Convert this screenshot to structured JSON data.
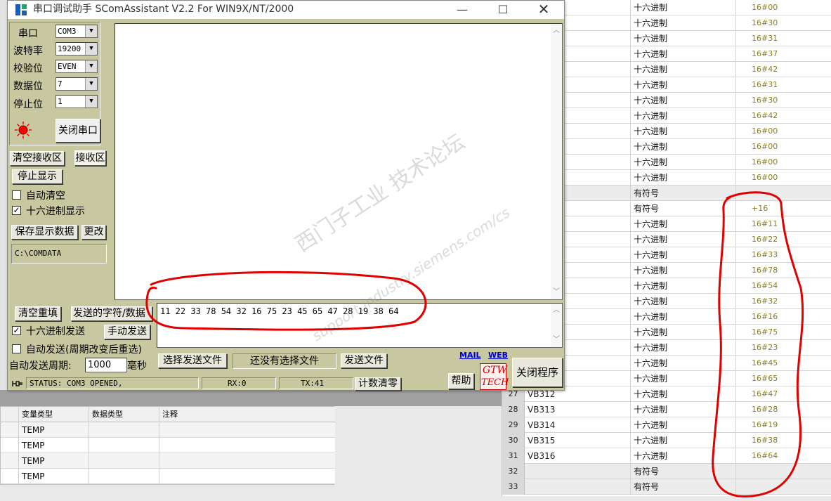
{
  "app": {
    "title": "串口调试助手 SComAssistant V2.2 For WIN9X/NT/2000",
    "minimize": "—",
    "maximize": "☐",
    "close": "✕"
  },
  "serial_settings": {
    "port_label": "串口",
    "port_value": "COM3",
    "baud_label": "波特率",
    "baud_value": "19200",
    "parity_label": "校验位",
    "parity_value": "EVEN",
    "databits_label": "数据位",
    "databits_value": "7",
    "stopbits_label": "停止位",
    "stopbits_value": "1",
    "close_port_button": "关闭串口",
    "indicator_color": "#ff0000"
  },
  "receive_controls": {
    "clear_receive_button": "清空接收区",
    "receive_area_label": "接收区",
    "stop_display_button": "停止显示",
    "auto_clear_label": "自动清空",
    "auto_clear_checked": false,
    "hex_display_label": "十六进制显示",
    "hex_display_checked": true,
    "save_data_button": "保存显示数据",
    "change_button": "更改",
    "save_path": "C:\\COMDATA"
  },
  "send_controls": {
    "clear_refill_button": "清空重填",
    "send_string_label": "发送的字符/数据",
    "send_text": "11 22 33 78 54 32 16 75 23 45 65 47 28 19 38 64",
    "hex_send_label": "十六进制发送",
    "hex_send_checked": true,
    "manual_send_button": "手动发送",
    "auto_send_label": "自动发送(周期改变后重选)",
    "auto_send_checked": false,
    "auto_send_period_label": "自动发送周期:",
    "auto_send_period_value": "1000",
    "period_unit": "毫秒",
    "select_file_button": "选择发送文件",
    "file_status": "还没有选择文件",
    "send_file_button": "发送文件",
    "mail_link": "MAIL",
    "web_link": "WEB",
    "help_button": "帮助",
    "logo_text_1": "GTW",
    "logo_text_2": "TECH",
    "close_program_button": "关闭程序"
  },
  "status_bar": {
    "status": "STATUS: COM3 OPENED,",
    "rx": "RX:0",
    "tx": "TX:41",
    "reset_count_button": "计数清零"
  },
  "status_table": {
    "rows": [
      {
        "num": "",
        "addr": "",
        "fmt": "十六进制",
        "val": "16#00"
      },
      {
        "num": "",
        "addr": "",
        "fmt": "十六进制",
        "val": "16#30"
      },
      {
        "num": "",
        "addr": "",
        "fmt": "十六进制",
        "val": "16#31"
      },
      {
        "num": "",
        "addr": "",
        "fmt": "十六进制",
        "val": "16#37"
      },
      {
        "num": "",
        "addr": "",
        "fmt": "十六进制",
        "val": "16#42"
      },
      {
        "num": "",
        "addr": "",
        "fmt": "十六进制",
        "val": "16#31"
      },
      {
        "num": "",
        "addr": "",
        "fmt": "十六进制",
        "val": "16#30"
      },
      {
        "num": "",
        "addr": "",
        "fmt": "十六进制",
        "val": "16#42"
      },
      {
        "num": "",
        "addr": "",
        "fmt": "十六进制",
        "val": "16#00"
      },
      {
        "num": "",
        "addr": "",
        "fmt": "十六进制",
        "val": "16#00"
      },
      {
        "num": "",
        "addr": "",
        "fmt": "十六进制",
        "val": "16#00"
      },
      {
        "num": "",
        "addr": "",
        "fmt": "十六进制",
        "val": "16#00"
      },
      {
        "num": "",
        "addr": "",
        "fmt": "有符号",
        "val": ""
      },
      {
        "num": "",
        "addr": "",
        "fmt": "有符号",
        "val": "+16"
      },
      {
        "num": "",
        "addr": "",
        "fmt": "十六进制",
        "val": "16#11"
      },
      {
        "num": "",
        "addr": "",
        "fmt": "十六进制",
        "val": "16#22"
      },
      {
        "num": "",
        "addr": "",
        "fmt": "十六进制",
        "val": "16#33"
      },
      {
        "num": "",
        "addr": "",
        "fmt": "十六进制",
        "val": "16#78"
      },
      {
        "num": "",
        "addr": "",
        "fmt": "十六进制",
        "val": "16#54"
      },
      {
        "num": "",
        "addr": "",
        "fmt": "十六进制",
        "val": "16#32"
      },
      {
        "num": "",
        "addr": "",
        "fmt": "十六进制",
        "val": "16#16"
      },
      {
        "num": "",
        "addr": "",
        "fmt": "十六进制",
        "val": "16#75"
      },
      {
        "num": "",
        "addr": "",
        "fmt": "十六进制",
        "val": "16#23"
      },
      {
        "num": "",
        "addr": "",
        "fmt": "十六进制",
        "val": "16#45"
      },
      {
        "num": "",
        "addr": "",
        "fmt": "十六进制",
        "val": "16#65"
      },
      {
        "num": "27",
        "addr": "VB312",
        "fmt": "十六进制",
        "val": "16#47"
      },
      {
        "num": "28",
        "addr": "VB313",
        "fmt": "十六进制",
        "val": "16#28"
      },
      {
        "num": "29",
        "addr": "VB314",
        "fmt": "十六进制",
        "val": "16#19"
      },
      {
        "num": "30",
        "addr": "VB315",
        "fmt": "十六进制",
        "val": "16#38"
      },
      {
        "num": "31",
        "addr": "VB316",
        "fmt": "十六进制",
        "val": "16#64"
      },
      {
        "num": "32",
        "addr": "",
        "fmt": "有符号",
        "val": ""
      },
      {
        "num": "33",
        "addr": "",
        "fmt": "有符号",
        "val": ""
      }
    ]
  },
  "var_table": {
    "headers": [
      "变量类型",
      "数据类型",
      "注释"
    ],
    "rows": [
      {
        "var_type": "TEMP",
        "data_type": "",
        "comment": ""
      },
      {
        "var_type": "TEMP",
        "data_type": "",
        "comment": ""
      },
      {
        "var_type": "TEMP",
        "data_type": "",
        "comment": ""
      },
      {
        "var_type": "TEMP",
        "data_type": "",
        "comment": ""
      }
    ]
  },
  "watermark": {
    "text": "西门子工业  技术论坛",
    "url": "support.industry.siemens.com/cs"
  },
  "colors": {
    "client_bg": "#c8c8a0",
    "annotation": "#e00000",
    "value_text": "#8a7d1e"
  }
}
